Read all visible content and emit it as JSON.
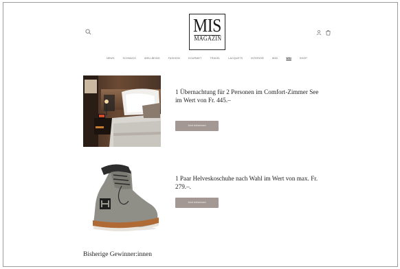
{
  "header": {
    "logo_top": "MIS",
    "logo_bottom": "MAGAZIN",
    "search_icon": "search-icon",
    "user_icon": "user-icon",
    "cart_icon": "cart-icon"
  },
  "nav": {
    "items": [
      {
        "label": "News"
      },
      {
        "label": "Schmuck"
      },
      {
        "label": "Wellbeing"
      },
      {
        "label": "Fashion"
      },
      {
        "label": "Gourmet"
      },
      {
        "label": "Travel"
      },
      {
        "label": "Lacquets"
      },
      {
        "label": "Interior"
      },
      {
        "label": "Wiki"
      },
      {
        "label": "Win"
      },
      {
        "label": "Shop"
      }
    ],
    "active_index": 9
  },
  "prizes": [
    {
      "title": "1 Übernachtung für 2 Personen im Comfort-Zimmer See im Wert von Fr. 445.–",
      "button": "Jetzt teilnehmen"
    },
    {
      "title": "1 Paar Helveskoschuhe nach Wahl im Wert von max. Fr. 279.–.",
      "button": "Jetzt teilnehmen"
    }
  ],
  "winners_heading": "Bisherige Gewinner:innen",
  "colors": {
    "button_bg": "#a39894",
    "text": "#222222",
    "nav_text": "#666666"
  }
}
